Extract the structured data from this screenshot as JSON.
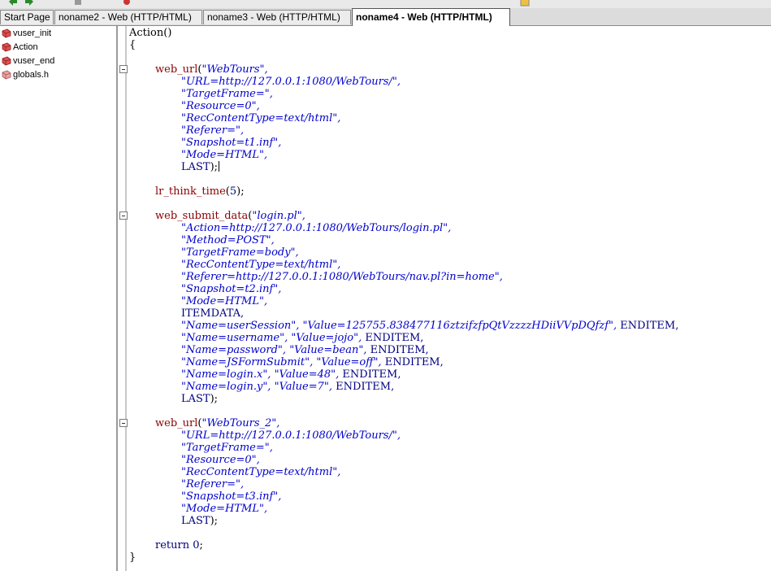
{
  "tabs": [
    {
      "label": "Start Page",
      "active": false
    },
    {
      "label": "noname2 - Web (HTTP/HTML)",
      "active": false
    },
    {
      "label": "noname3 - Web (HTTP/HTML)",
      "active": false
    },
    {
      "label": "noname4 - Web (HTTP/HTML)",
      "active": true
    }
  ],
  "tree": [
    {
      "label": "vuser_init",
      "icon": "script-icon"
    },
    {
      "label": "Action",
      "icon": "script-icon"
    },
    {
      "label": "vuser_end",
      "icon": "script-icon"
    },
    {
      "label": "globals.h",
      "icon": "header-file-icon"
    }
  ],
  "code": {
    "l1": "Action()",
    "l2": "{",
    "u1_fn": "web_url",
    "u1_a": "\"WebTours\",",
    "u1_1": "\"URL=http://127.0.0.1:1080/WebTours/\",",
    "u1_2": "\"TargetFrame=\",",
    "u1_3": "\"Resource=0\",",
    "u1_4": "\"RecContentType=text/html\",",
    "u1_5": "\"Referer=\",",
    "u1_6": "\"Snapshot=t1.inf\",",
    "u1_7": "\"Mode=HTML\",",
    "u1_last": "LAST",
    "tt_fn": "lr_think_time",
    "tt_arg": "5",
    "s_fn": "web_submit_data",
    "s_a": "\"login.pl\",",
    "s_1": "\"Action=http://127.0.0.1:1080/WebTours/login.pl\",",
    "s_2": "\"Method=POST\",",
    "s_3": "\"TargetFrame=body\",",
    "s_4": "\"RecContentType=text/html\",",
    "s_5": "\"Referer=http://127.0.0.1:1080/WebTours/nav.pl?in=home\",",
    "s_6": "\"Snapshot=t2.inf\",",
    "s_7": "\"Mode=HTML\",",
    "s_itemdata": "ITEMDATA,",
    "s_r1n": "\"Name=userSession\",",
    "s_r1v": "\"Value=125755.838477116ztzifzfpQtVzzzzHDiiVVpDQfzf\",",
    "s_r2n": "\"Name=username\",",
    "s_r2v": "\"Value=jojo\",",
    "s_r3n": "\"Name=password\",",
    "s_r3v": "\"Value=bean\",",
    "s_r4n": "\"Name=JSFormSubmit\",",
    "s_r4v": "\"Value=off\",",
    "s_r5n": "\"Name=login.x\",",
    "s_r5v": "\"Value=48\",",
    "s_r6n": "\"Name=login.y\",",
    "s_r6v": "\"Value=7\",",
    "enditem": "ENDITEM,",
    "s_last": "LAST",
    "u2_fn": "web_url",
    "u2_a": "\"WebTours_2\",",
    "u2_1": "\"URL=http://127.0.0.1:1080/WebTours/\",",
    "u2_2": "\"TargetFrame=\",",
    "u2_3": "\"Resource=0\",",
    "u2_4": "\"RecContentType=text/html\",",
    "u2_5": "\"Referer=\",",
    "u2_6": "\"Snapshot=t3.inf\",",
    "u2_7": "\"Mode=HTML\",",
    "u2_last": "LAST",
    "ret": "return",
    "ret_val": "0",
    "close": "}"
  },
  "colors": {
    "function": "#8b0000",
    "string": "#0000cd",
    "keyword": "#000080"
  }
}
